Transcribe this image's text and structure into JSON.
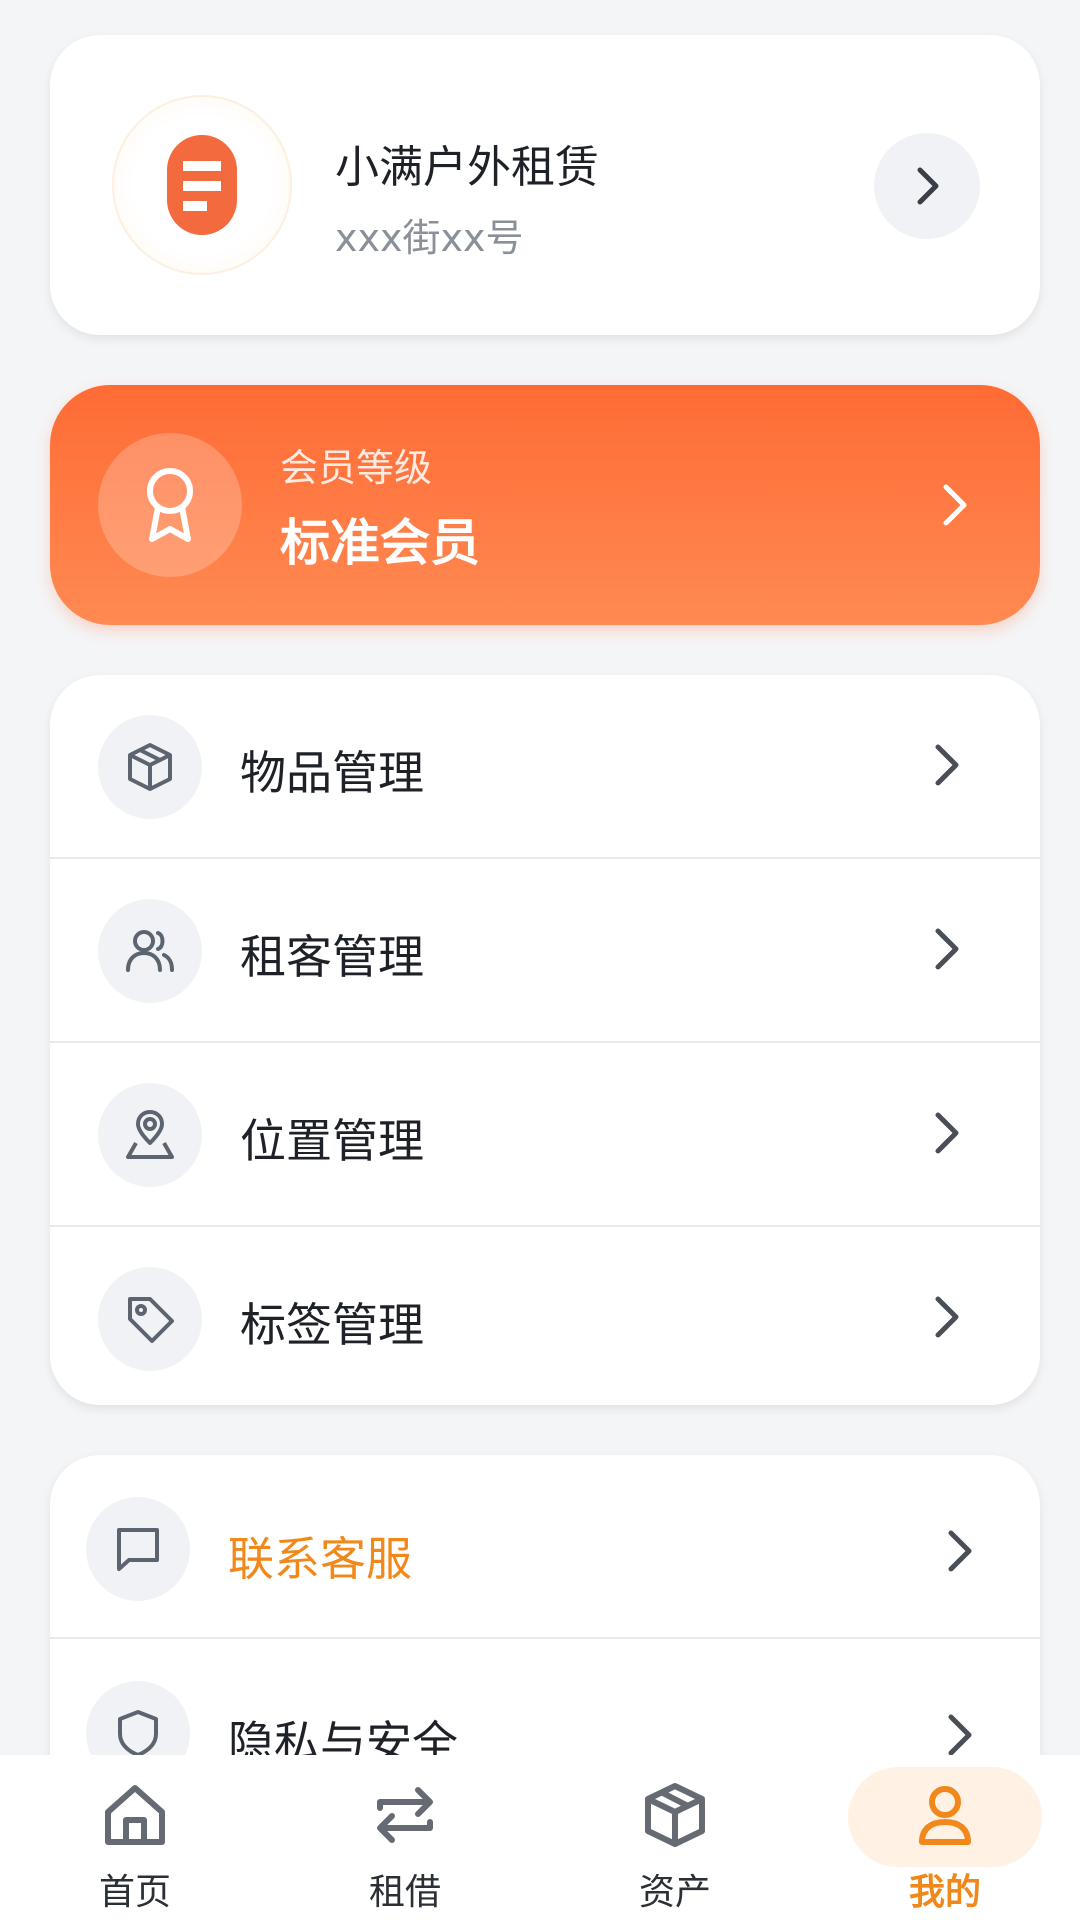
{
  "shop": {
    "name": "小满户外租赁",
    "address": "xxx街xx号"
  },
  "membership": {
    "label": "会员等级",
    "level": "标准会员"
  },
  "management_menu": [
    {
      "label": "物品管理",
      "icon": "box-icon"
    },
    {
      "label": "租客管理",
      "icon": "users-icon"
    },
    {
      "label": "位置管理",
      "icon": "location-pin-icon"
    },
    {
      "label": "标签管理",
      "icon": "tag-icon"
    }
  ],
  "support_menu": [
    {
      "label": "联系客服",
      "icon": "message-icon"
    },
    {
      "label": "隐私与安全",
      "icon": "shield-icon"
    }
  ],
  "bottom_nav": [
    {
      "label": "首页",
      "icon": "home-icon"
    },
    {
      "label": "租借",
      "icon": "swap-icon"
    },
    {
      "label": "资产",
      "icon": "box-icon"
    },
    {
      "label": "我的",
      "icon": "user-icon",
      "active": true
    }
  ],
  "colors": {
    "accent_orange": "#ff6b35",
    "accent_text": "#f0881b",
    "background": "#f4f5f7"
  }
}
